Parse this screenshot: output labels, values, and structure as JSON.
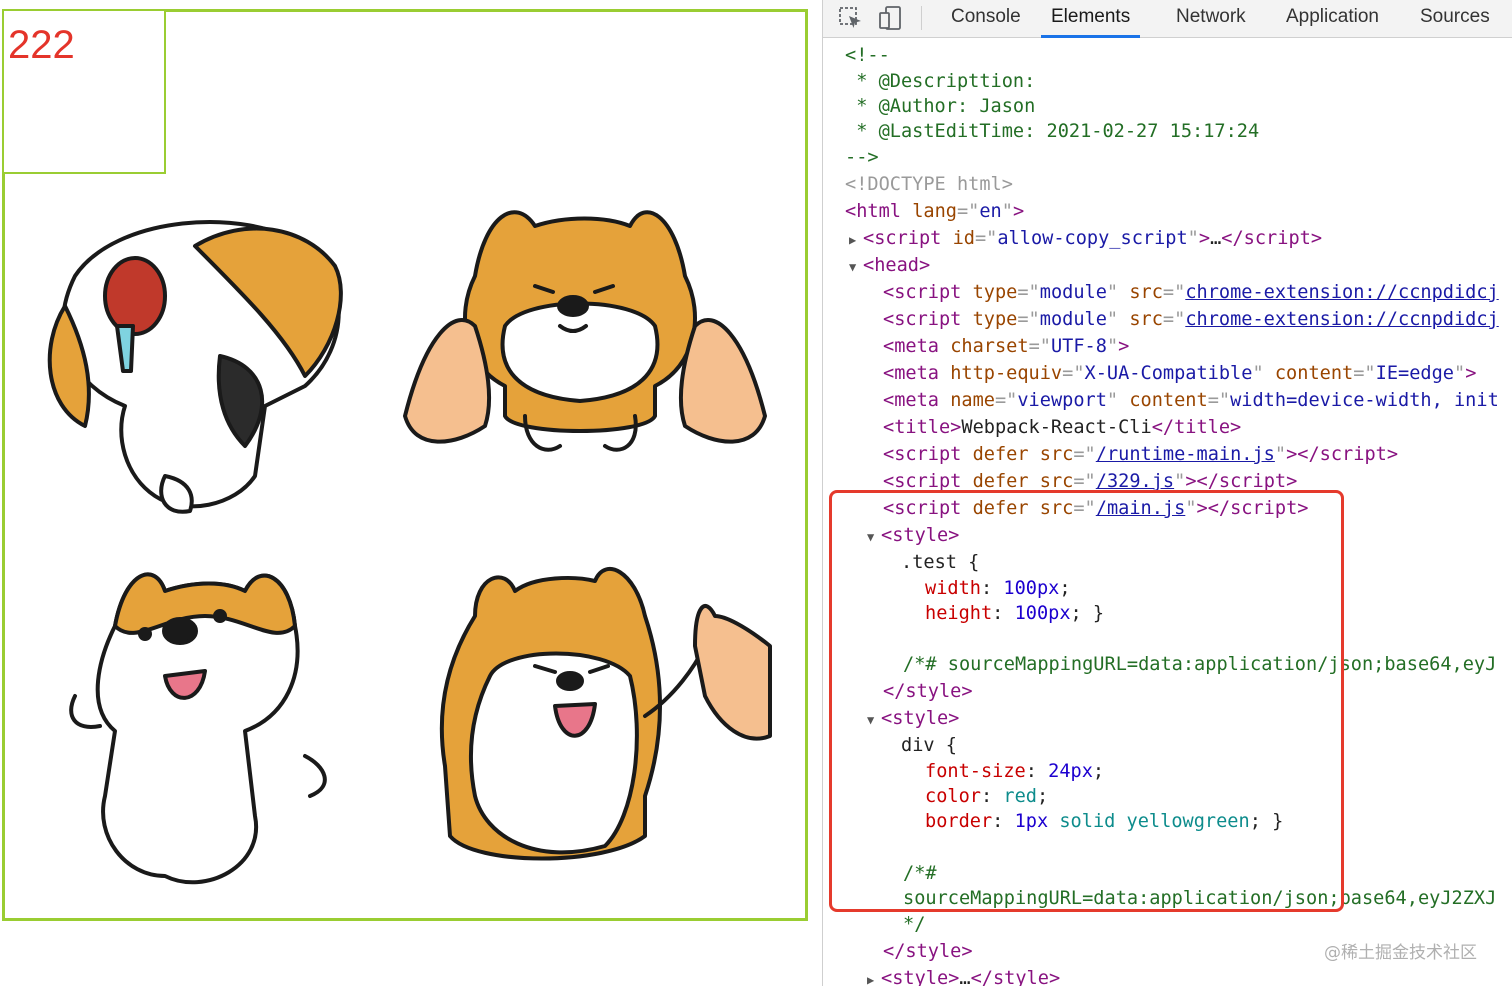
{
  "page": {
    "test_text": "222"
  },
  "devtools": {
    "tabs": [
      "Console",
      "Elements",
      "Network",
      "Application",
      "Sources"
    ],
    "active_tab": "Elements",
    "lines": {
      "l1": "<!--",
      "l2": " * @Descripttion:",
      "l3": " * @Author: Jason",
      "l4": " * @LastEditTime: 2021-02-27 15:17:24",
      "l5": "-->",
      "doctype": "<!DOCTYPE html>",
      "html_lang": "en",
      "script_id": "allow-copy_script",
      "ext_src": "chrome-extension://ccnpdidcj",
      "charset": "UTF-8",
      "http_equiv": "X-UA-Compatible",
      "ie_edge": "IE=edge",
      "viewport_name": "viewport",
      "viewport_content": "width=device-width, init",
      "title": "Webpack-React-Cli",
      "src_runtime": "/runtime-main.js",
      "src_329": "/329.js",
      "src_main": "/main.js",
      "sel_test": ".test {",
      "width_val": "100px",
      "height_val": "100px",
      "source_map_1": "/*# sourceMappingURL=data:application/json;base64,eyJ",
      "sel_div": "div {",
      "font_size_val": "24px",
      "color_val": "red",
      "border_num": "1px",
      "border_style": "solid",
      "border_color": "yellowgreen",
      "comment_open": "/*#",
      "source_map_2": "sourceMappingURL=data:application/json;base64,eyJ2ZXJ",
      "comment_close": "*/"
    }
  },
  "watermark": "@稀土掘金技术社区",
  "colors": {
    "border": "#9acd32",
    "text_red": "#e4342a",
    "highlight": "#e53a2c",
    "tab_underline": "#1a73e8"
  },
  "icons": [
    "inspect-element-icon",
    "device-toggle-icon"
  ]
}
